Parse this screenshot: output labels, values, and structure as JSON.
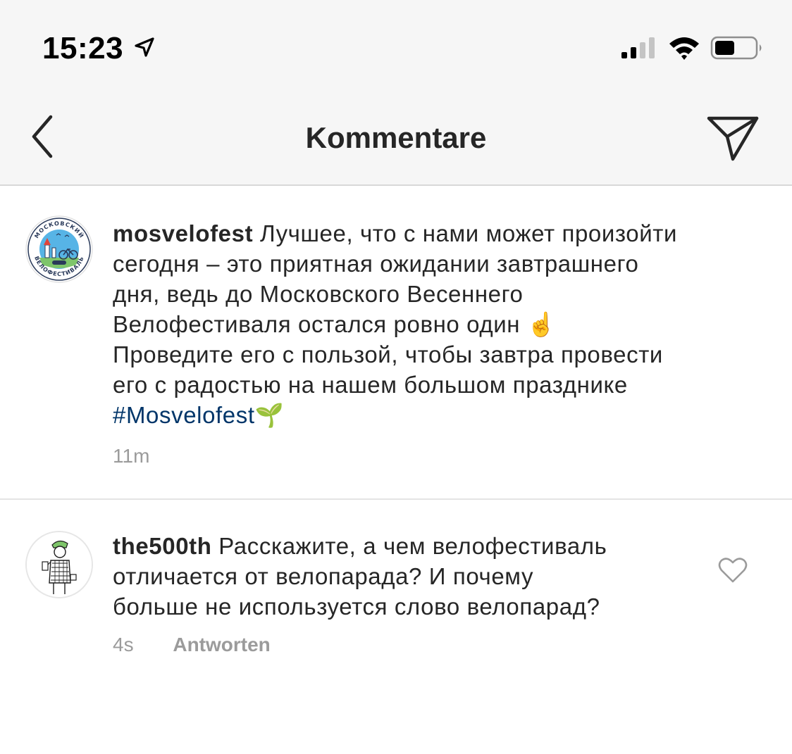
{
  "status_bar": {
    "time": "15:23",
    "location_icon": "location-arrow-icon",
    "signal_icon": "cellular-signal-icon",
    "wifi_icon": "wifi-icon",
    "battery_icon": "battery-icon",
    "battery_level": 0.5
  },
  "nav": {
    "title": "Kommentare",
    "back_icon": "chevron-left-icon",
    "share_icon": "paper-plane-icon"
  },
  "caption": {
    "username": "mosvelofest",
    "text_lines": [
      "Лучшее, что с нами может произойти",
      "сегодня – это приятная ожидании завтрашнего",
      "дня, ведь до Московского Весеннего",
      "Велофестиваля остался ровно один ☝️",
      "Проведите его с пользой, чтобы завтра провести",
      "его с радостью на нашем большом празднике"
    ],
    "hashtag": "#Mosvelofest",
    "emoji": "🌱",
    "time": "11m",
    "avatar_text": "МОСКОВСКИЙ ВЕЛОФЕСТИВАЛЬ 2019"
  },
  "reply": {
    "username": "the500th",
    "text_lines": [
      "Расскажите, а чем велофестиваль",
      "отличается от велопарада? И почему",
      "больше не используется слово велопарад?"
    ],
    "time": "4s",
    "reply_label": "Antworten",
    "like_icon": "heart-outline-icon"
  },
  "colors": {
    "header_bg": "#f6f6f6",
    "text": "#262626",
    "meta": "#9b9b9b",
    "hashtag": "#003569"
  }
}
